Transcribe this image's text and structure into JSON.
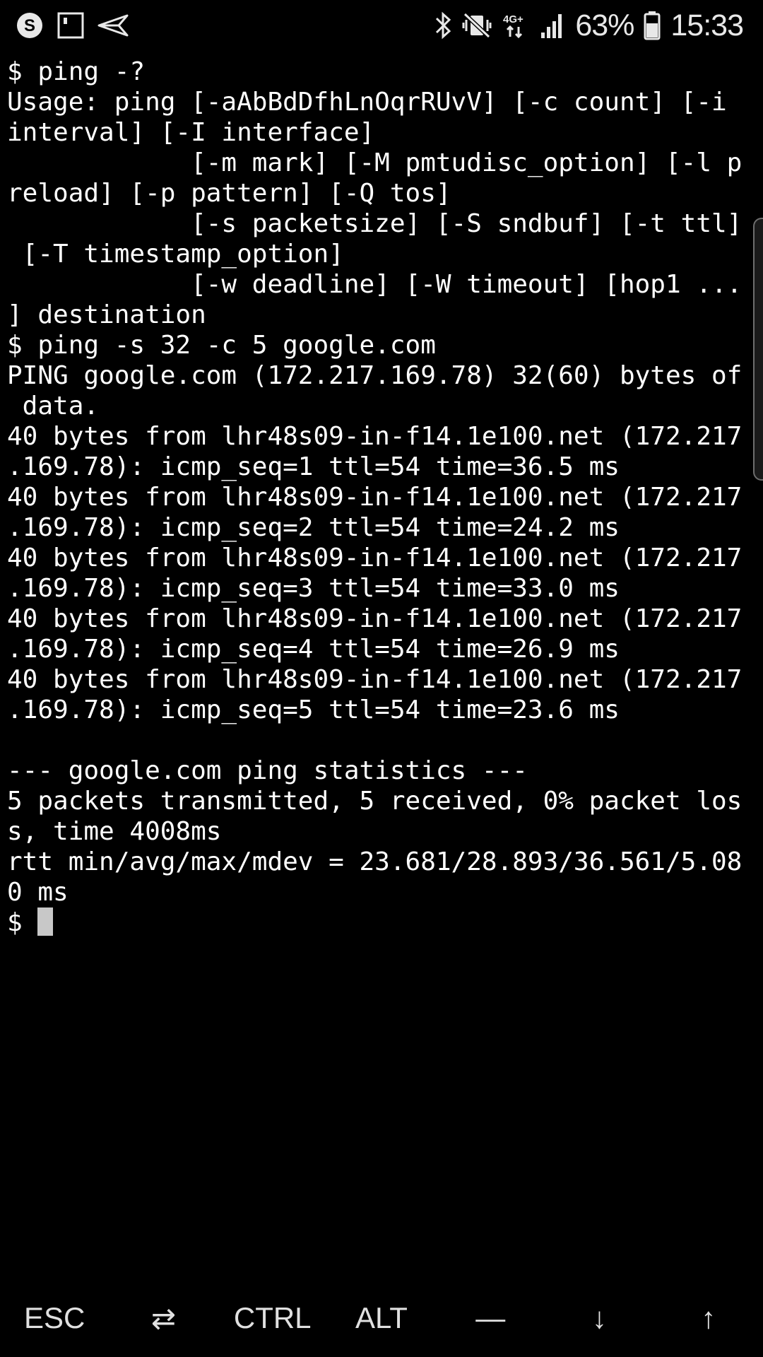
{
  "status_bar": {
    "left_icons": [
      "s-circle-icon",
      "notification-square-icon",
      "paper-plane-icon"
    ],
    "right_icons": [
      "bluetooth-icon",
      "vibrate-mute-icon",
      "4g-plus-data-icon",
      "signal-icon"
    ],
    "battery_percent": "63%",
    "battery_level": 0.63,
    "time": "15:33"
  },
  "terminal": {
    "lines": [
      "$ ping -?",
      "Usage: ping [-aAbBdDfhLnOqrRUvV] [-c count] [-i",
      "interval] [-I interface]",
      "            [-m mark] [-M pmtudisc_option] [-l p",
      "reload] [-p pattern] [-Q tos]",
      "            [-s packetsize] [-S sndbuf] [-t ttl]",
      " [-T timestamp_option]",
      "            [-w deadline] [-W timeout] [hop1 ...",
      "] destination",
      "$ ping -s 32 -c 5 google.com",
      "PING google.com (172.217.169.78) 32(60) bytes of",
      " data.",
      "40 bytes from lhr48s09-in-f14.1e100.net (172.217",
      ".169.78): icmp_seq=1 ttl=54 time=36.5 ms",
      "40 bytes from lhr48s09-in-f14.1e100.net (172.217",
      ".169.78): icmp_seq=2 ttl=54 time=24.2 ms",
      "40 bytes from lhr48s09-in-f14.1e100.net (172.217",
      ".169.78): icmp_seq=3 ttl=54 time=33.0 ms",
      "40 bytes from lhr48s09-in-f14.1e100.net (172.217",
      ".169.78): icmp_seq=4 ttl=54 time=26.9 ms",
      "40 bytes from lhr48s09-in-f14.1e100.net (172.217",
      ".169.78): icmp_seq=5 ttl=54 time=23.6 ms",
      "",
      "--- google.com ping statistics ---",
      "5 packets transmitted, 5 received, 0% packet los",
      "s, time 4008ms",
      "rtt min/avg/max/mdev = 23.681/28.893/36.561/5.08",
      "0 ms"
    ],
    "prompt": "$ "
  },
  "extra_keys": [
    {
      "name": "key-esc",
      "label": "ESC"
    },
    {
      "name": "key-tab",
      "label": "⇄"
    },
    {
      "name": "key-ctrl",
      "label": "CTRL"
    },
    {
      "name": "key-alt",
      "label": "ALT"
    },
    {
      "name": "key-dash",
      "label": "—"
    },
    {
      "name": "key-down-arrow",
      "label": "↓"
    },
    {
      "name": "key-up-arrow",
      "label": "↑"
    }
  ],
  "colors": {
    "background": "#000000",
    "text": "#ffffff",
    "cursor": "#c8c8c8"
  }
}
